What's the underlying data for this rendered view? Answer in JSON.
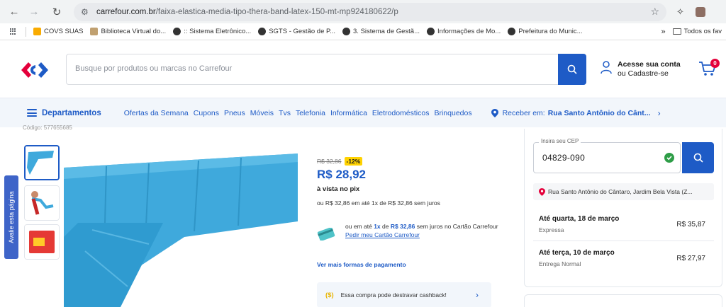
{
  "browser": {
    "url_domain": "carrefour.com.br",
    "url_path": "/faixa-elastica-media-tipo-thera-band-latex-150-mt-mp924180622/p"
  },
  "bookmarks": [
    {
      "label": "COVS SUAS",
      "icon": "folder-icon"
    },
    {
      "label": "Biblioteca Virtual do...",
      "icon": "library-icon"
    },
    {
      "label": ":: Sistema Eletrônico...",
      "icon": "globe-icon"
    },
    {
      "label": "SGTS - Gestão de P...",
      "icon": "globe-icon"
    },
    {
      "label": "3. Sistema de Gestã...",
      "icon": "globe-icon"
    },
    {
      "label": "Informações de Mo...",
      "icon": "globe-icon"
    },
    {
      "label": "Prefeitura do Munic...",
      "icon": "globe-icon"
    }
  ],
  "bookmarks_more": "»",
  "bookmarks_all": "Todos os fav",
  "header": {
    "search_placeholder": "Busque por produtos ou marcas no Carrefour",
    "account_line1": "Acesse sua conta",
    "account_line2": "ou Cadastre-se",
    "cart_count": "0"
  },
  "nav": {
    "departments": "Departamentos",
    "links": [
      "Ofertas da Semana",
      "Cupons",
      "Pneus",
      "Móveis",
      "Tvs",
      "Telefonia",
      "Informática",
      "Eletrodomésticos",
      "Brinquedos"
    ],
    "receive_label": "Receber em:",
    "receive_address": "Rua Santo Antônio do Cânt..."
  },
  "product": {
    "code": "Código: 577655685"
  },
  "feedback_tab": "Avalie esta página",
  "pricing": {
    "old_price": "R$ 32,86",
    "discount": "-12%",
    "price": "R$ 28,92",
    "pix": "à vista no pix",
    "installments": "ou R$ 32,86 em até 1x de R$ 32,86 sem juros",
    "card_prefix": "ou em até",
    "card_x": "1x",
    "card_de": "de",
    "card_amount": "R$ 32,86",
    "card_suffix": "sem juros no Cartão Carrefour",
    "card_link": "Pedir meu Cartão Carrefour",
    "more_payments": "Ver mais formas de pagamento",
    "cashback_icon": "($)",
    "cashback_text": "Essa compra pode destravar cashback!"
  },
  "shipping": {
    "cep_label": "Insira seu CEP",
    "cep_value": "04829-090",
    "address": "Rua Santo Antônio do Cântaro, Jardim Bela Vista (Z...",
    "options": [
      {
        "title": "Até quarta, 18 de março",
        "type": "Expressa",
        "price": "R$ 35,87"
      },
      {
        "title": "Até terça, 10 de março",
        "type": "Entrega Normal",
        "price": "R$ 27,97"
      }
    ]
  },
  "colors": {
    "brand_blue": "#1e5bc6",
    "brand_red": "#e4003b",
    "discount_yellow": "#ffd200",
    "product_blue": "#3fa9dc"
  }
}
